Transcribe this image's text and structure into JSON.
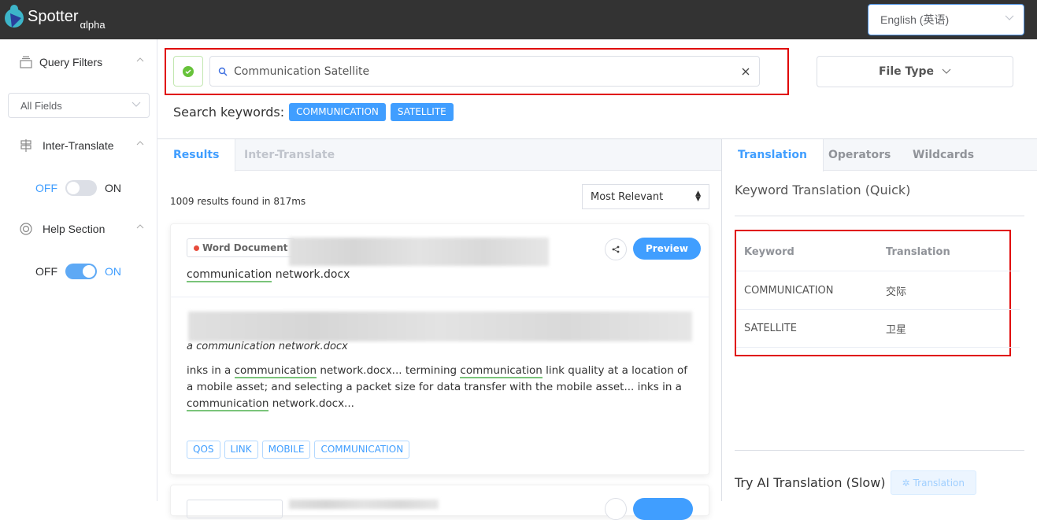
{
  "app": {
    "name": "Spotter",
    "edition": "αlpha",
    "language_select": "English (英语)"
  },
  "sidebar": {
    "query_filters": {
      "label": "Query Filters",
      "field_select": "All Fields"
    },
    "inter_translate": {
      "label": "Inter-Translate",
      "off_label": "OFF",
      "on_label": "ON",
      "enabled": false
    },
    "help_section": {
      "label": "Help Section",
      "off_label": "OFF",
      "on_label": "ON",
      "enabled": true
    }
  },
  "search": {
    "query": "Communication Satellite",
    "file_type_label": "File Type",
    "keywords_label": "Search keywords:",
    "keywords": [
      "COMMUNICATION",
      "SATELLITE"
    ]
  },
  "results": {
    "tabs": [
      {
        "label": "Results",
        "active": true
      },
      {
        "label": "Inter-Translate",
        "active": false
      }
    ],
    "count_text": "1009 results found in 817ms",
    "sort_select": "Most Relevant",
    "cards": [
      {
        "type_badge": "Word Document",
        "filename_hl": "communication",
        "filename_rest": " network.docx",
        "subtitle": "a communication network.docx",
        "snippet": [
          {
            "t": "inks in a ",
            "hl": false
          },
          {
            "t": "communication",
            "hl": true
          },
          {
            "t": " network.docx... termining ",
            "hl": false
          },
          {
            "t": "communication",
            "hl": true
          },
          {
            "t": " link quality at a location of a mobile asset; and selecting a packet size for data transfer with the mobile asset... inks in a ",
            "hl": false
          },
          {
            "t": "communication",
            "hl": true
          },
          {
            "t": " network.docx...",
            "hl": false
          }
        ],
        "tags": [
          "QOS",
          "LINK",
          "MOBILE",
          "COMMUNICATION"
        ],
        "preview_label": "Preview"
      }
    ]
  },
  "translation_panel": {
    "tabs": [
      {
        "label": "Translation",
        "active": true
      },
      {
        "label": "Operators",
        "active": false
      },
      {
        "label": "Wildcards",
        "active": false
      }
    ],
    "quick_title": "Keyword Translation (Quick)",
    "table_headers": [
      "Keyword",
      "Translation"
    ],
    "rows": [
      {
        "keyword": "COMMUNICATION",
        "translation": "交际"
      },
      {
        "keyword": "SATELLITE",
        "translation": "卫星"
      }
    ],
    "ai_label": "Try AI Translation (Slow)",
    "ai_button": "Translation"
  },
  "colors": {
    "accent": "#409eff",
    "highlight_box": "#e00000",
    "topbar": "#333333",
    "success": "#67c23a"
  }
}
